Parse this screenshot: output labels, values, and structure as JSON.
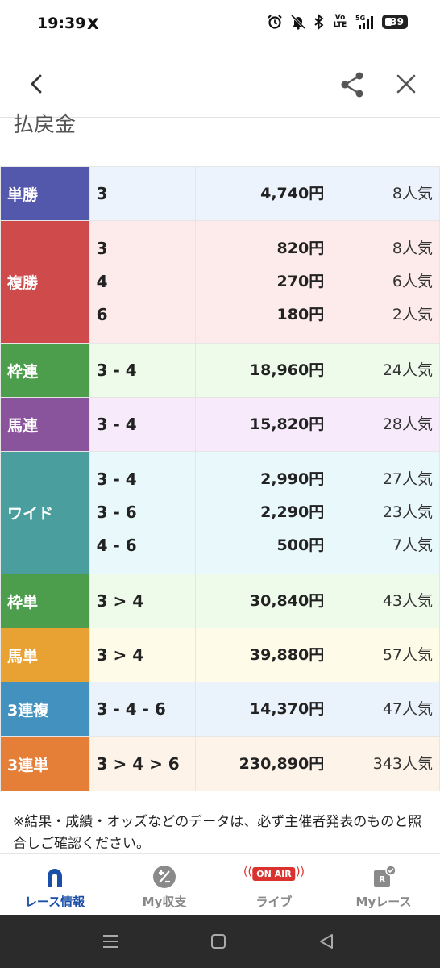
{
  "status_bar": {
    "time": "19:39",
    "x_icon": "X",
    "battery": "39",
    "volte": "Vo\nLTE",
    "signal_label": "5G",
    "icons": [
      "alarm-icon",
      "mute-icon",
      "bluetooth-icon",
      "volte-icon",
      "signal-icon",
      "battery-icon"
    ]
  },
  "header": {
    "icons": [
      "back-chevron-icon",
      "share-icon",
      "close-icon"
    ]
  },
  "section": {
    "title": "払戻金"
  },
  "payouts": [
    {
      "type": "単勝",
      "color": "#5458ad",
      "bg": "#edf3fd",
      "rows": [
        {
          "combo": "3",
          "amount": "4,740円",
          "popularity": "8人気"
        }
      ]
    },
    {
      "type": "複勝",
      "color": "#cf4b4b",
      "bg": "#fdebeb",
      "rows": [
        {
          "combo": "3",
          "amount": "820円",
          "popularity": "8人気"
        },
        {
          "combo": "4",
          "amount": "270円",
          "popularity": "6人気"
        },
        {
          "combo": "6",
          "amount": "180円",
          "popularity": "2人気"
        }
      ]
    },
    {
      "type": "枠連",
      "color": "#4c9e4c",
      "bg": "#eefbea",
      "rows": [
        {
          "combo": "3 - 4",
          "amount": "18,960円",
          "popularity": "24人気"
        }
      ]
    },
    {
      "type": "馬連",
      "color": "#8a549c",
      "bg": "#f6eafb",
      "rows": [
        {
          "combo": "3 - 4",
          "amount": "15,820円",
          "popularity": "28人気"
        }
      ]
    },
    {
      "type": "ワイド",
      "color": "#4a9e9e",
      "bg": "#e9f8fb",
      "rows": [
        {
          "combo": "3 - 4",
          "amount": "2,990円",
          "popularity": "27人気"
        },
        {
          "combo": "3 - 6",
          "amount": "2,290円",
          "popularity": "23人気"
        },
        {
          "combo": "4 - 6",
          "amount": "500円",
          "popularity": "7人気"
        }
      ]
    },
    {
      "type": "枠単",
      "color": "#4c9e4c",
      "bg": "#eefbea",
      "rows": [
        {
          "combo": "3 > 4",
          "amount": "30,840円",
          "popularity": "43人気"
        }
      ]
    },
    {
      "type": "馬単",
      "color": "#e8a233",
      "bg": "#fffbe9",
      "rows": [
        {
          "combo": "3 > 4",
          "amount": "39,880円",
          "popularity": "57人気"
        }
      ]
    },
    {
      "type": "3連複",
      "color": "#4291bf",
      "bg": "#eaf3fb",
      "rows": [
        {
          "combo": "3 - 4 - 6",
          "amount": "14,370円",
          "popularity": "47人気"
        }
      ]
    },
    {
      "type": "3連単",
      "color": "#e57e37",
      "bg": "#fdf3e8",
      "rows": [
        {
          "combo": "3 > 4 > 6",
          "amount": "230,890円",
          "popularity": "343人気"
        }
      ]
    }
  ],
  "note": "※結果・成績・オッズなどのデータは、必ず主催者発表のものと照合しご確認ください。",
  "bottom_nav": {
    "items": [
      {
        "label": "レース情報",
        "icon": "horseshoe-icon",
        "active": true
      },
      {
        "label": "My収支",
        "icon": "plus-minus-icon",
        "active": false
      },
      {
        "label": "ライブ",
        "icon": "on-air-icon",
        "badge": "ON AIR",
        "active": false
      },
      {
        "label": "Myレース",
        "icon": "my-race-icon",
        "badge": "R",
        "active": false
      }
    ]
  },
  "system_nav": {
    "icons": [
      "recents-icon",
      "home-icon",
      "back-triangle-icon"
    ]
  },
  "colors": {
    "accent": "#1a4fa8",
    "onair": "#d9322f"
  }
}
